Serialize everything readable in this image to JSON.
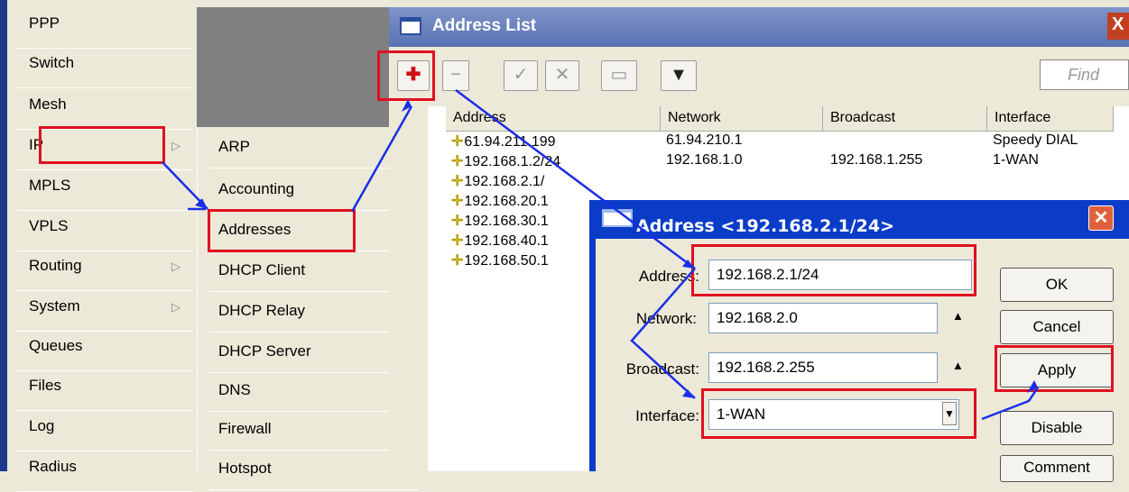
{
  "menu": {
    "items": [
      "PPP",
      "Switch",
      "Mesh",
      "IP",
      "MPLS",
      "VPLS",
      "Routing",
      "System",
      "Queues",
      "Files",
      "Log",
      "Radius"
    ]
  },
  "submenu": {
    "items": [
      "ARP",
      "Accounting",
      "Addresses",
      "DHCP Client",
      "DHCP Relay",
      "DHCP Server",
      "DNS",
      "Firewall",
      "Hotspot"
    ]
  },
  "address_list": {
    "title": "Address List",
    "find_placeholder": "Find",
    "columns": [
      "Address",
      "Network",
      "Broadcast",
      "Interface"
    ],
    "rows": [
      {
        "address": "61.94.211.199",
        "network": "61.94.210.1",
        "broadcast": "",
        "interface": "Speedy DIAL"
      },
      {
        "address": "192.168.1.2/24",
        "network": "192.168.1.0",
        "broadcast": "192.168.1.255",
        "interface": "1-WAN"
      },
      {
        "address": "192.168.2.1/",
        "network": "",
        "broadcast": "",
        "interface": ""
      },
      {
        "address": "192.168.20.1",
        "network": "",
        "broadcast": "",
        "interface": ""
      },
      {
        "address": "192.168.30.1",
        "network": "",
        "broadcast": "",
        "interface": ""
      },
      {
        "address": "192.168.40.1",
        "network": "",
        "broadcast": "",
        "interface": ""
      },
      {
        "address": "192.168.50.1",
        "network": "",
        "broadcast": "",
        "interface": ""
      }
    ]
  },
  "dialog": {
    "title": "Address <192.168.2.1/24>",
    "address_label": "Address:",
    "address_value": "192.168.2.1/24",
    "network_label": "Network:",
    "network_value": "192.168.2.0",
    "broadcast_label": "Broadcast:",
    "broadcast_value": "192.168.2.255",
    "interface_label": "Interface:",
    "interface_value": "1-WAN",
    "buttons": [
      "OK",
      "Cancel",
      "Apply",
      "Disable",
      "Comment"
    ]
  },
  "colors": {
    "highlight": "#e01020",
    "arrow": "#1a2ee8",
    "title_bar": "#0a3cc8"
  }
}
